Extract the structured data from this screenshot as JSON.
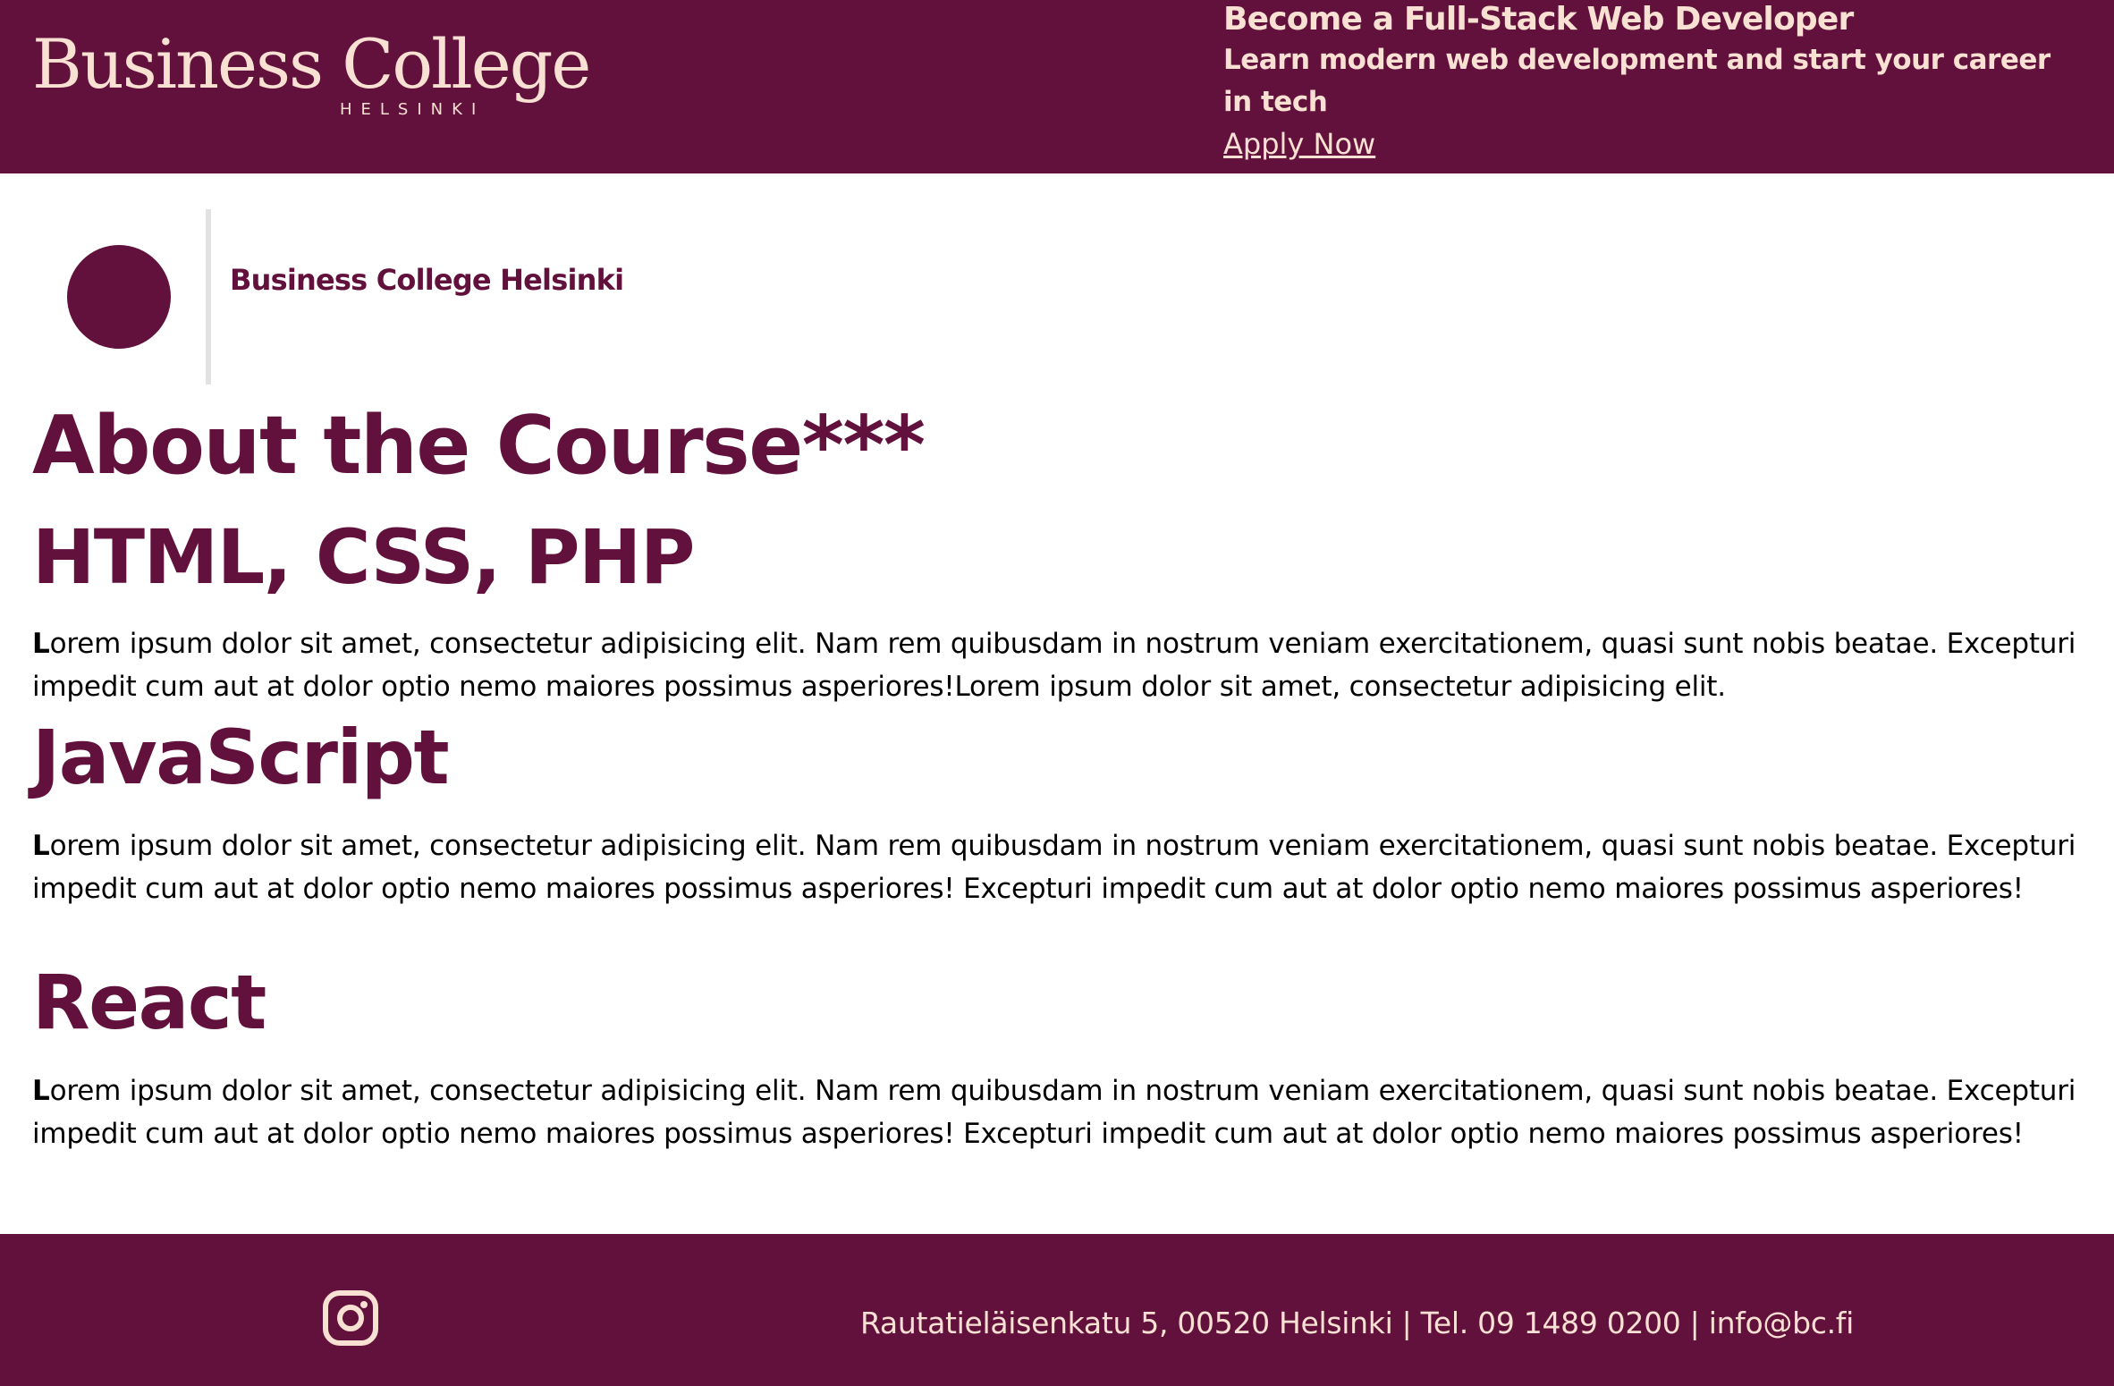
{
  "header": {
    "logo_main": "Business College",
    "logo_sub": "HELSINKI",
    "promo_title": "Become a Full-Stack Web Developer",
    "promo_subtitle": "Learn modern web development and start your career in tech",
    "promo_link": "Apply Now"
  },
  "brand": {
    "name": "Business College Helsinki"
  },
  "main": {
    "heading": "About the Course***",
    "sections": [
      {
        "title": "HTML, CSS, PHP",
        "first_letter": "L",
        "text": "orem ipsum dolor sit amet, consectetur adipisicing elit. Nam rem quibusdam in nostrum veniam exercitationem, quasi sunt nobis beatae. Excepturi impedit cum aut at dolor optio nemo maiores possimus asperiores!Lorem ipsum dolor sit amet, consectetur adipisicing elit."
      },
      {
        "title": "JavaScript",
        "first_letter": "L",
        "text": "orem ipsum dolor sit amet, consectetur adipisicing elit. Nam rem quibusdam in nostrum veniam exercitationem, quasi sunt nobis beatae. Excepturi impedit cum aut at dolor optio nemo maiores possimus asperiores! Excepturi impedit cum aut at dolor optio nemo maiores possimus asperiores!"
      },
      {
        "title": "React",
        "first_letter": "L",
        "text": "orem ipsum dolor sit amet, consectetur adipisicing elit. Nam rem quibusdam in nostrum veniam exercitationem, quasi sunt nobis beatae. Excepturi impedit cum aut at dolor optio nemo maiores possimus asperiores! Excepturi impedit cum aut at dolor optio nemo maiores possimus asperiores!"
      }
    ]
  },
  "footer": {
    "contact": "Rautatieläisenkatu 5, 00520 Helsinki | Tel. 09 1489 0200 | info@bc.fi",
    "social_icon": "instagram-icon"
  },
  "colors": {
    "brand": "#62113c",
    "accent_text": "#f8e0d2",
    "divider": "#e2e2e2"
  }
}
